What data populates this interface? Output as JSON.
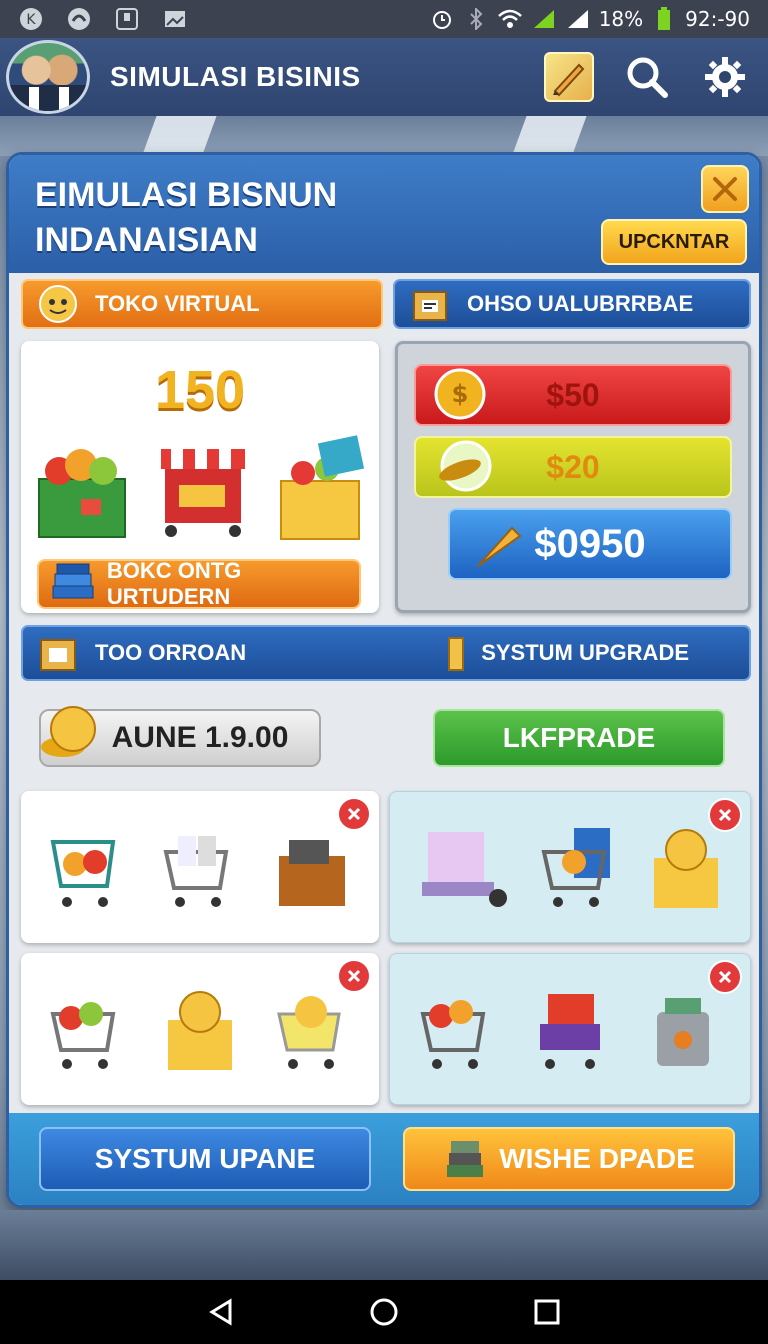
{
  "status_bar": {
    "battery": "18%",
    "time": "92:-90"
  },
  "app_header": {
    "title": "SIMULASI BISINIS",
    "icons": [
      "avatar",
      "edit-icon",
      "search-icon",
      "gear-icon"
    ]
  },
  "panel": {
    "title_line1": "EIMULASI BISNUN",
    "title_line2": "INDANAISIAN",
    "upgrade_label": "UPCKNTAR",
    "toko_bar": "TOKO VIRTUAL",
    "ohso_bar": "OHSO UALUBRRBAE",
    "toko_count": "150",
    "toko_button": "BOKC ONTG URTUDERN",
    "prices": [
      "$50",
      "$20",
      "$0950"
    ],
    "section2_left": "TOO ORROAN",
    "section2_right": "SYSTUM UPGRADE",
    "coin_value": "AUNE 1.9.00",
    "green_button": "LKFPRADE",
    "bottom_left_button": "SYSTUM UPANE",
    "bottom_right_button": "WISHE DPADE"
  },
  "colors": {
    "accent_blue": "#2b5fa8",
    "accent_orange": "#e26f14",
    "accent_green": "#2d9a2b",
    "accent_red": "#c91a1a",
    "coin_gold": "#f2b320"
  }
}
